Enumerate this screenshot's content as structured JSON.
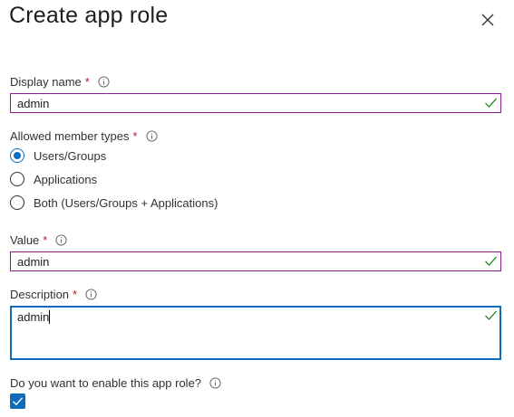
{
  "header": {
    "title": "Create app role"
  },
  "display_name": {
    "label": "Display name",
    "required_marker": "*",
    "value": "admin",
    "valid": true
  },
  "member_types": {
    "label": "Allowed member types",
    "required_marker": "*",
    "options": [
      {
        "label": "Users/Groups",
        "selected": true
      },
      {
        "label": "Applications",
        "selected": false
      },
      {
        "label": "Both (Users/Groups + Applications)",
        "selected": false
      }
    ]
  },
  "value_field": {
    "label": "Value",
    "required_marker": "*",
    "value": "admin",
    "valid": true
  },
  "description": {
    "label": "Description",
    "required_marker": "*",
    "value": "admin",
    "valid": true
  },
  "enable": {
    "label": "Do you want to enable this app role?",
    "checked": true
  },
  "colors": {
    "accent": "#0f6cbd",
    "valid_border": "#8a1f8f",
    "valid_check": "#107c10",
    "required": "#a4262c"
  }
}
